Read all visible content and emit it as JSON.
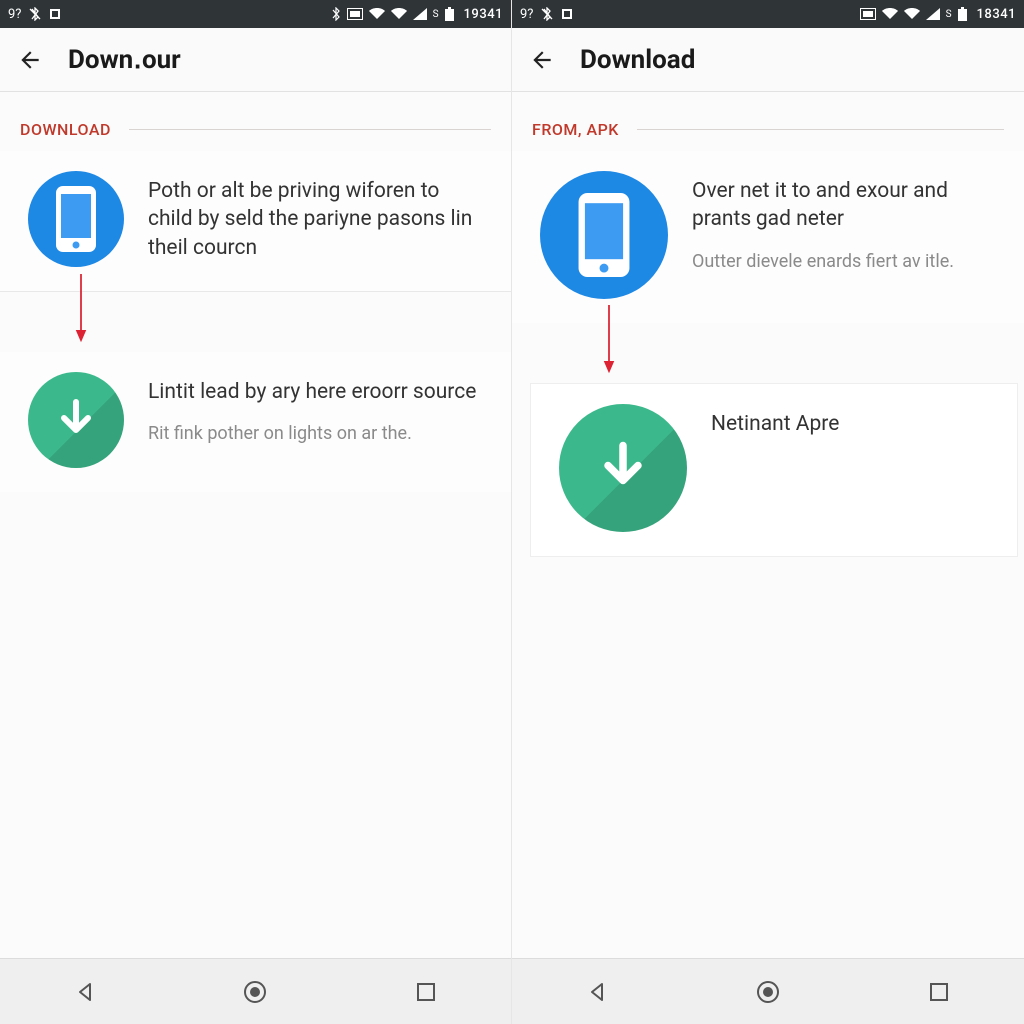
{
  "left": {
    "status": {
      "left_text": "9?",
      "clock": "19341"
    },
    "appbar": {
      "title": "Down․our"
    },
    "section_label": "DOWNLOAD",
    "step1": {
      "title": "Poth or alt be priving wiforen to child by seld the pariyne pasons lin theil courcn"
    },
    "step2": {
      "title": "Lintit lead by ary here eroorr source",
      "sub": "Rit fink pother on lights on ar the."
    }
  },
  "right": {
    "status": {
      "left_text": "9?",
      "clock": "18341"
    },
    "appbar": {
      "title": "Download"
    },
    "section_label": "FROM, APK",
    "step1": {
      "title": "Over net it to and exour and prants gad neter",
      "sub": "Outter dievele enards fiert av itle."
    },
    "step2": {
      "title": "Netinant Apre"
    }
  }
}
